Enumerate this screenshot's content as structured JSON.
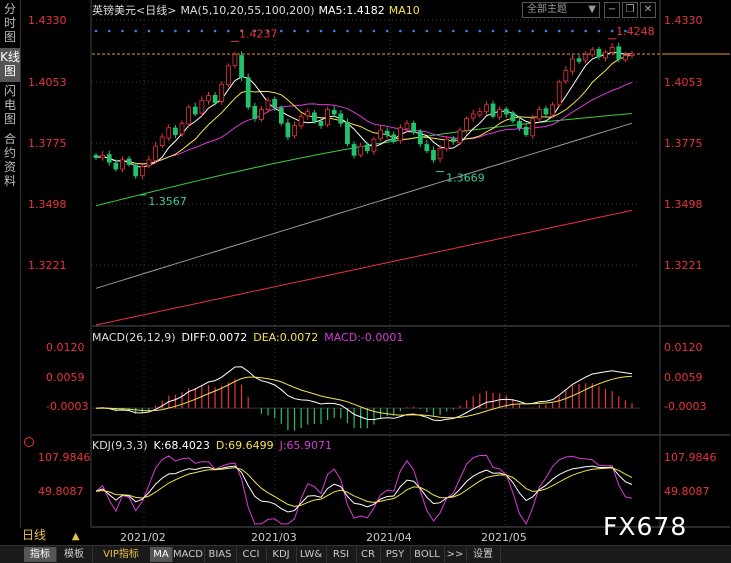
{
  "sidebar": {
    "items": [
      {
        "label": "分时图"
      },
      {
        "label": "K线图"
      },
      {
        "label": "闪电图"
      },
      {
        "label": "合约资料"
      }
    ]
  },
  "topbar": {
    "symbol": "英镑美元<日线>",
    "ma_params": "MA(5,10,20,55,100,200)",
    "ma5_label": "MA5:1.4182",
    "ma10_label": "MA10",
    "topic_button": "全部主题",
    "topic_arrow": "▼"
  },
  "price_axis": {
    "ticks": [
      "1.4330",
      "1.4053",
      "1.3775",
      "1.3498",
      "1.3221"
    ],
    "ref_label": "1.4330"
  },
  "annotations": {
    "high1": "1.4237",
    "high2": "1.4248",
    "low1": "1.3567",
    "low2": "1.3669"
  },
  "macd": {
    "title": "MACD(26,12,9)",
    "diff": "DIFF:0.0072",
    "dea": "DEA:0.0072",
    "macd": "MACD:-0.0001",
    "ticks": [
      "0.0120",
      "0.0059",
      "-0.0003"
    ]
  },
  "kdj": {
    "title": "KDJ(9,3,3)",
    "k": "K:68.4023",
    "d": "D:69.6499",
    "j": "J:65.9071",
    "ticks": [
      "107.9846",
      "49.8087"
    ]
  },
  "time_axis": {
    "period": "日线",
    "period_arrow": "▲",
    "labels": [
      "2021/02",
      "2021/03",
      "2021/04",
      "2021/05"
    ]
  },
  "bottom_tabs": [
    "指标",
    "模板",
    "VIP指标",
    "MA",
    "MACD",
    "BIAS",
    "CCI",
    "KDJ",
    "LW&",
    "RSI",
    "CR",
    "PSY",
    "BOLL",
    ">>",
    "设置"
  ],
  "watermark": "FX678",
  "colors": {
    "up": "#e8333a",
    "down": "#25c26e",
    "ma5": "#ffffff",
    "ma10": "#f5e24a",
    "ma20": "#d93ad9",
    "ma55": "#3ecb3e",
    "ma100": "#9a9a9a",
    "ma200": "#e8333a",
    "axis_text": "#e8333a",
    "grid": "#3a3a3a"
  },
  "chart_data": {
    "type": "candlestick",
    "symbol": "GBP/USD",
    "period": "daily",
    "x_labels": [
      "2021/02",
      "2021/03",
      "2021/04",
      "2021/05"
    ],
    "ylim": [
      1.3221,
      1.433
    ],
    "y_ticks": [
      1.433,
      1.4053,
      1.3775,
      1.3498,
      1.3221
    ],
    "current_price": 1.4182,
    "annotated_extremes": [
      {
        "type": "low",
        "value": 1.3567
      },
      {
        "type": "high",
        "value": 1.4237
      },
      {
        "type": "low",
        "value": 1.3669
      },
      {
        "type": "high",
        "value": 1.4248
      }
    ],
    "closes": [
      1.373,
      1.374,
      1.371,
      1.368,
      1.372,
      1.37,
      1.365,
      1.369,
      1.372,
      1.378,
      1.382,
      1.386,
      1.383,
      1.388,
      1.395,
      1.392,
      1.398,
      1.4,
      1.397,
      1.405,
      1.413,
      1.418,
      1.408,
      1.395,
      1.39,
      1.394,
      1.398,
      1.395,
      1.388,
      1.382,
      1.387,
      1.391,
      1.393,
      1.389,
      1.387,
      1.394,
      1.392,
      1.388,
      1.379,
      1.374,
      1.378,
      1.376,
      1.381,
      1.385,
      1.383,
      1.38,
      1.386,
      1.388,
      1.384,
      1.379,
      1.376,
      1.372,
      1.377,
      1.381,
      1.38,
      1.385,
      1.39,
      1.392,
      1.393,
      1.396,
      1.391,
      1.394,
      1.392,
      1.389,
      1.386,
      1.383,
      1.39,
      1.394,
      1.392,
      1.396,
      1.406,
      1.411,
      1.416,
      1.415,
      1.418,
      1.42,
      1.417,
      1.419,
      1.421,
      1.416,
      1.4175,
      1.4182
    ],
    "series": [
      {
        "name": "MA5",
        "last": 1.4182
      },
      {
        "name": "MA10"
      },
      {
        "name": "MA20"
      },
      {
        "name": "MA55"
      },
      {
        "name": "MA100"
      },
      {
        "name": "MA200"
      }
    ],
    "macd": {
      "params": "26,12,9",
      "diff": 0.0072,
      "dea": 0.0072,
      "macd": -0.0001,
      "ylim": [
        -0.004,
        0.015
      ],
      "y_ticks": [
        0.012,
        0.0059,
        -0.0003
      ]
    },
    "kdj": {
      "params": "9,3,3",
      "k": 68.4023,
      "d": 69.6499,
      "j": 65.9071,
      "y_ticks": [
        107.9846,
        49.8087
      ]
    }
  }
}
